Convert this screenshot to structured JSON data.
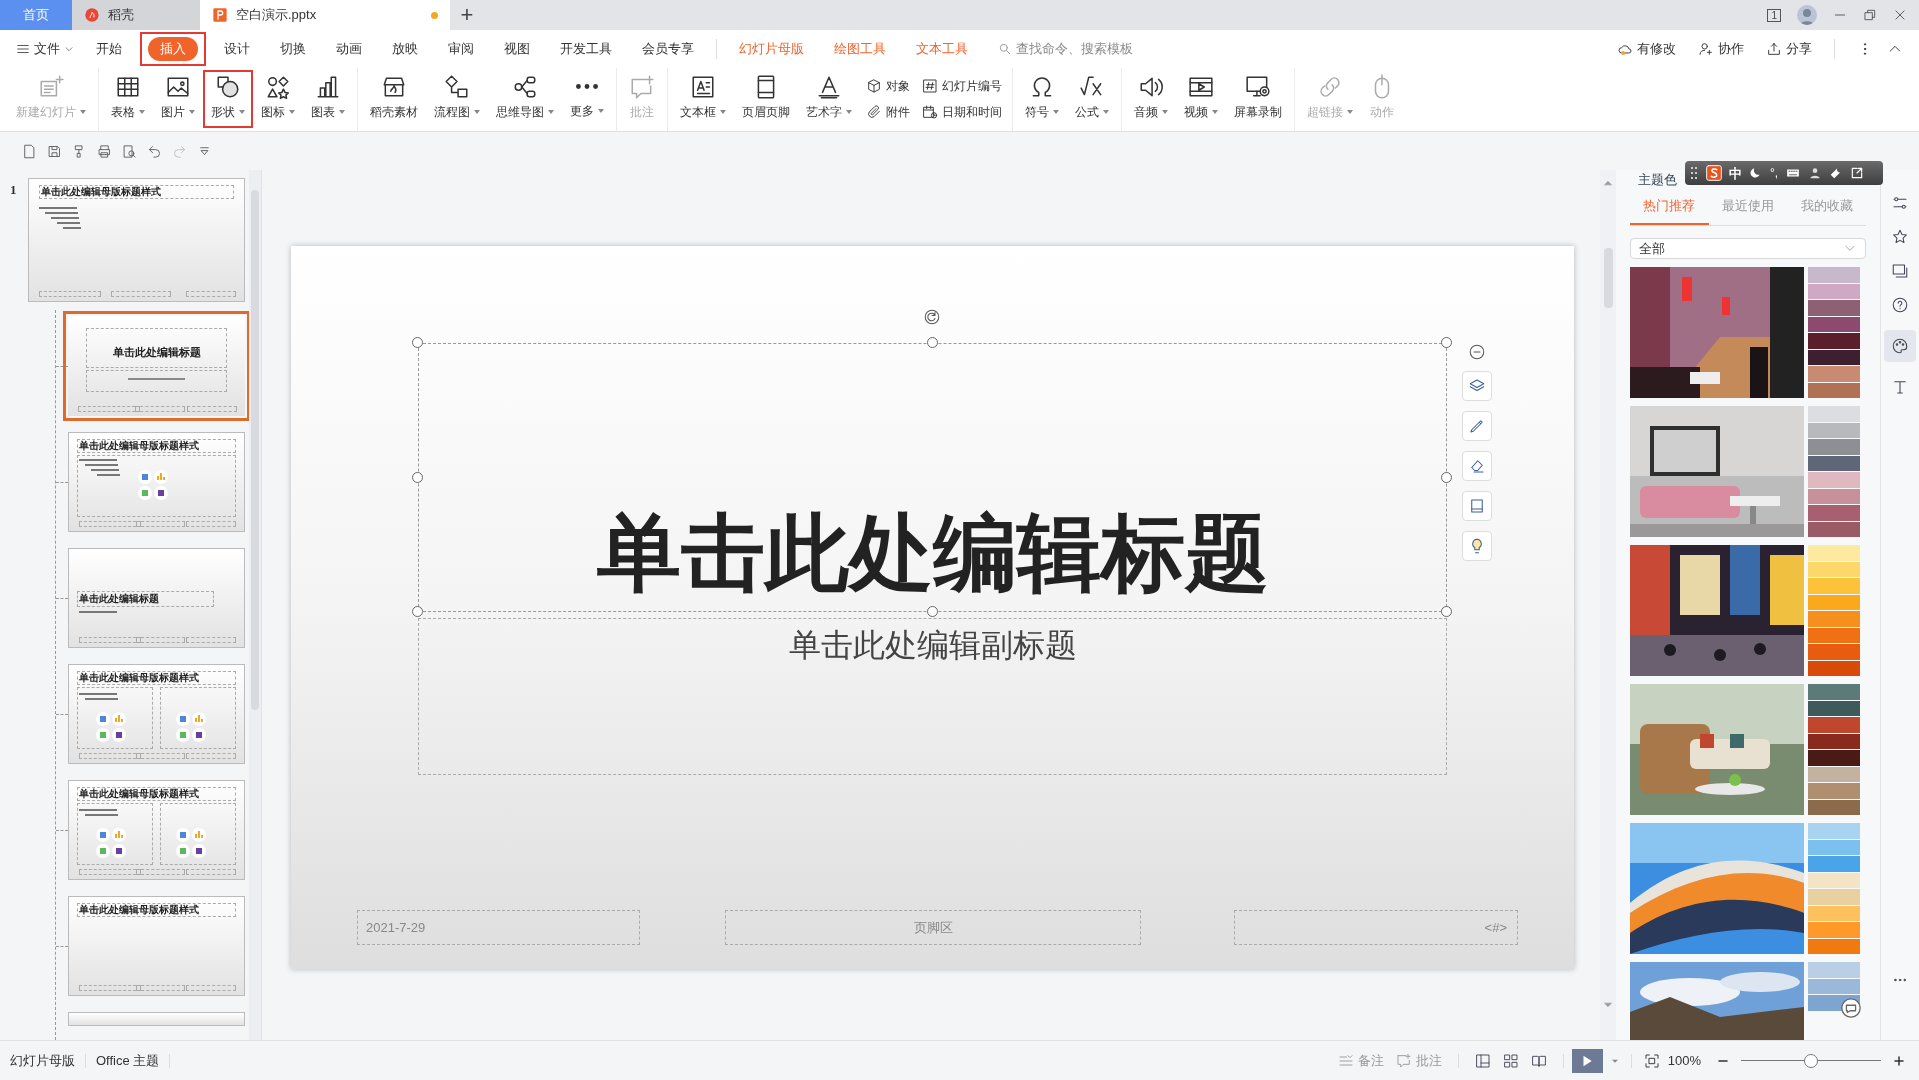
{
  "title_bar": {
    "tabs": [
      {
        "label": "首页",
        "kind": "home",
        "selected": false,
        "modified": false
      },
      {
        "label": "稻壳",
        "kind": "app",
        "selected": false,
        "modified": false
      },
      {
        "label": "空白演示.pptx",
        "kind": "document",
        "selected": true,
        "modified": true
      }
    ],
    "new_tab": "+",
    "window_count": "1"
  },
  "menu": {
    "file": "文件",
    "items": [
      {
        "label": "开始",
        "kind": "main",
        "selected": false,
        "annotated": false
      },
      {
        "label": "插入",
        "kind": "main",
        "selected": true,
        "annotated": true
      },
      {
        "label": "设计",
        "kind": "main",
        "selected": false,
        "annotated": false
      },
      {
        "label": "切换",
        "kind": "main",
        "selected": false,
        "annotated": false
      },
      {
        "label": "动画",
        "kind": "main",
        "selected": false,
        "annotated": false
      },
      {
        "label": "放映",
        "kind": "main",
        "selected": false,
        "annotated": false
      },
      {
        "label": "审阅",
        "kind": "main",
        "selected": false,
        "annotated": false
      },
      {
        "label": "视图",
        "kind": "main",
        "selected": false,
        "annotated": false
      },
      {
        "label": "开发工具",
        "kind": "main",
        "selected": false,
        "annotated": false
      },
      {
        "label": "会员专享",
        "kind": "main",
        "selected": false,
        "annotated": false
      },
      {
        "label": "幻灯片母版",
        "kind": "context",
        "selected": false,
        "annotated": false
      },
      {
        "label": "绘图工具",
        "kind": "context",
        "selected": false,
        "annotated": false
      },
      {
        "label": "文本工具",
        "kind": "context",
        "selected": false,
        "annotated": false
      }
    ],
    "search": {
      "placeholder": "查找命令、搜索模板"
    },
    "actions": [
      "有修改",
      "协作",
      "分享"
    ]
  },
  "ribbon": {
    "groups": [
      {
        "items": [
          {
            "kind": "large",
            "label": "新建幻灯片",
            "dropdown": true,
            "disabled": true,
            "annotated": false
          }
        ]
      },
      {
        "items": [
          {
            "kind": "large",
            "label": "表格",
            "dropdown": true,
            "disabled": false,
            "annotated": false
          },
          {
            "kind": "large",
            "label": "图片",
            "dropdown": true,
            "disabled": false,
            "annotated": false
          },
          {
            "kind": "large",
            "label": "形状",
            "dropdown": true,
            "disabled": false,
            "annotated": true
          },
          {
            "kind": "large",
            "label": "图标",
            "dropdown": true,
            "disabled": false,
            "annotated": false
          },
          {
            "kind": "large",
            "label": "图表",
            "dropdown": true,
            "disabled": false,
            "annotated": false
          }
        ]
      },
      {
        "items": [
          {
            "kind": "large",
            "label": "稻壳素材",
            "dropdown": false,
            "disabled": false,
            "annotated": false
          },
          {
            "kind": "large",
            "label": "流程图",
            "dropdown": true,
            "disabled": false,
            "annotated": false
          },
          {
            "kind": "large",
            "label": "思维导图",
            "dropdown": true,
            "disabled": false,
            "annotated": false
          },
          {
            "kind": "large",
            "label": "更多",
            "dropdown": true,
            "disabled": false,
            "annotated": false
          }
        ]
      },
      {
        "items": [
          {
            "kind": "large",
            "label": "批注",
            "dropdown": false,
            "disabled": true,
            "annotated": false
          }
        ]
      },
      {
        "items": [
          {
            "kind": "large",
            "label": "文本框",
            "dropdown": true,
            "disabled": false,
            "annotated": false
          },
          {
            "kind": "large",
            "label": "页眉页脚",
            "dropdown": false,
            "disabled": false,
            "annotated": false
          },
          {
            "kind": "large",
            "label": "艺术字",
            "dropdown": true,
            "disabled": false,
            "annotated": false
          },
          {
            "kind": "small",
            "label": "对象",
            "dropdown": false,
            "disabled": false,
            "annotated": false
          },
          {
            "kind": "small",
            "label": "附件",
            "dropdown": false,
            "disabled": false,
            "annotated": false
          },
          {
            "kind": "small",
            "label": "幻灯片编号",
            "dropdown": false,
            "disabled": false,
            "annotated": false
          },
          {
            "kind": "small",
            "label": "日期和时间",
            "dropdown": false,
            "disabled": false,
            "annotated": false
          }
        ]
      },
      {
        "items": [
          {
            "kind": "large",
            "label": "符号",
            "dropdown": true,
            "disabled": false,
            "annotated": false
          },
          {
            "kind": "large",
            "label": "公式",
            "dropdown": true,
            "disabled": false,
            "annotated": false
          }
        ]
      },
      {
        "items": [
          {
            "kind": "large",
            "label": "音频",
            "dropdown": true,
            "disabled": false,
            "annotated": false
          },
          {
            "kind": "large",
            "label": "视频",
            "dropdown": true,
            "disabled": false,
            "annotated": false
          },
          {
            "kind": "large",
            "label": "屏幕录制",
            "dropdown": false,
            "disabled": false,
            "annotated": false
          }
        ]
      },
      {
        "items": [
          {
            "kind": "large",
            "label": "超链接",
            "dropdown": true,
            "disabled": true,
            "annotated": false
          },
          {
            "kind": "large",
            "label": "动作",
            "dropdown": false,
            "disabled": true,
            "annotated": false
          }
        ]
      }
    ]
  },
  "thumbnails": {
    "number": "1",
    "slides": [
      {
        "kind": "master",
        "title": "单击此处编辑母版标题样式",
        "selected": false
      },
      {
        "kind": "title",
        "title": "单击此处编辑标题",
        "selected": true
      },
      {
        "kind": "content",
        "title": "单击此处编辑母版标题样式",
        "selected": false
      },
      {
        "kind": "section",
        "title": "单击此处编辑标题",
        "selected": false
      },
      {
        "kind": "two",
        "title": "单击此处编辑母版标题样式",
        "selected": false
      },
      {
        "kind": "two",
        "title": "单击此处编辑母版标题样式",
        "selected": false
      },
      {
        "kind": "titleonly",
        "title": "单击此处编辑母版标题样式",
        "selected": false
      },
      {
        "kind": "blank",
        "selected": false
      }
    ]
  },
  "slide": {
    "title": "单击此处编辑标题",
    "subtitle": "单击此处编辑副标题",
    "date": "2021-7-29",
    "footer": "页脚区",
    "number": "<#>"
  },
  "ime_toolbar": {
    "mode": "中",
    "punctuation": "°,"
  },
  "theme_panel": {
    "title": "主题色",
    "tabs": [
      {
        "label": "热门推荐",
        "selected": true
      },
      {
        "label": "最近使用",
        "selected": false
      },
      {
        "label": "我的收藏",
        "selected": false
      }
    ],
    "filter": "全部",
    "schemes": [
      {
        "kind": "picture",
        "swatches": [
          {
            "color": "#c8b8cb"
          },
          {
            "color": "#cfa8c4"
          },
          {
            "color": "#8e6073"
          },
          {
            "color": "#8b4a6e"
          },
          {
            "color": "#5a1f2a"
          },
          {
            "color": "#3e1f30"
          },
          {
            "color": "#c98a72"
          },
          {
            "color": "#b07155"
          }
        ]
      },
      {
        "kind": "picture",
        "swatches": [
          {
            "color": "#dcdde0"
          },
          {
            "color": "#b8b9bd"
          },
          {
            "color": "#8e8f95"
          },
          {
            "color": "#5e6678"
          },
          {
            "color": "#e0b8c0"
          },
          {
            "color": "#c8909a"
          },
          {
            "color": "#a86070"
          },
          {
            "color": "#9b5b66"
          }
        ]
      },
      {
        "kind": "picture",
        "swatches": [
          {
            "color": "#fde9a0"
          },
          {
            "color": "#fcd86a"
          },
          {
            "color": "#fbc23a"
          },
          {
            "color": "#f9a91a"
          },
          {
            "color": "#f78f1e"
          },
          {
            "color": "#f07014"
          },
          {
            "color": "#e85c10"
          },
          {
            "color": "#d84a0a"
          }
        ]
      },
      {
        "kind": "picture",
        "swatches": [
          {
            "color": "#5b7a78"
          },
          {
            "color": "#3e5a5a"
          },
          {
            "color": "#c0462e"
          },
          {
            "color": "#8a2a1c"
          },
          {
            "color": "#4a1a14"
          },
          {
            "color": "#c4b2a0"
          },
          {
            "color": "#b08e70"
          },
          {
            "color": "#8c6a4c"
          }
        ]
      },
      {
        "kind": "picture",
        "swatches": [
          {
            "color": "#a8d4f2"
          },
          {
            "color": "#7cc0f0"
          },
          {
            "color": "#4aa4e8"
          },
          {
            "color": "#f2e4c4"
          },
          {
            "color": "#e8d0a0"
          },
          {
            "color": "#ffc060"
          },
          {
            "color": "#ff9a2a"
          },
          {
            "color": "#f07a10"
          }
        ]
      },
      {
        "kind": "picture",
        "swatches": [
          {
            "color": "#b8cfe6"
          },
          {
            "color": "#9ab8da"
          },
          {
            "color": "#7ea4d0"
          }
        ]
      }
    ]
  },
  "status_bar": {
    "view": "幻灯片母版",
    "theme": "Office 主题",
    "notes": "备注",
    "comments": "批注",
    "zoom": "100%",
    "zoom_slider": {
      "level": 0.5
    }
  }
}
